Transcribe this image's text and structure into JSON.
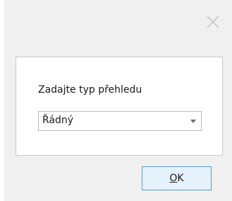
{
  "dialog": {
    "close_icon": "close-icon",
    "prompt": "Zadajte typ přehledu",
    "select": {
      "selected_value": "Řádný",
      "arrow_icon": "dropdown-arrow-icon"
    },
    "ok_button": {
      "mnemonic": "O",
      "rest": "K"
    }
  },
  "colors": {
    "dialog_background": "#f0f0f0",
    "panel_background": "#ffffff",
    "button_background": "#e5f1fb",
    "button_border": "#5a9bd4"
  }
}
